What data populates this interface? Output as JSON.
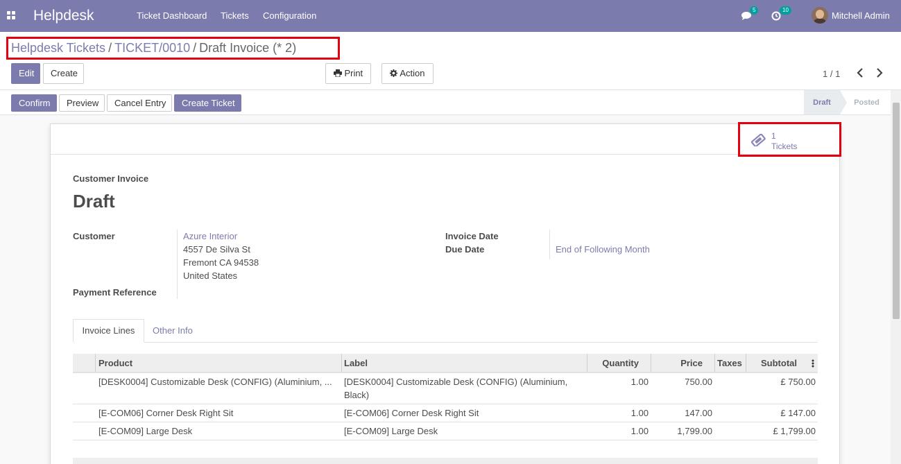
{
  "navbar": {
    "brand": "Helpdesk",
    "menu": [
      "Ticket Dashboard",
      "Tickets",
      "Configuration"
    ],
    "messages_count": "5",
    "activities_count": "10",
    "user_name": "Mitchell Admin"
  },
  "breadcrumb": {
    "root": "Helpdesk Tickets",
    "separator": "/",
    "ticket": "TICKET/0010",
    "current": "Draft Invoice (* 2)"
  },
  "toolbar": {
    "edit_label": "Edit",
    "create_label": "Create",
    "print_label": "Print",
    "action_label": "Action"
  },
  "pager": {
    "value": "1 / 1"
  },
  "statusbar": {
    "buttons": [
      "Confirm",
      "Preview",
      "Cancel Entry",
      "Create Ticket"
    ],
    "stages": [
      "Draft",
      "Posted"
    ],
    "active_stage": "Draft"
  },
  "smart_button": {
    "value": "1",
    "label": "Tickets"
  },
  "invoice": {
    "type_label": "Customer Invoice",
    "name": "Draft",
    "customer_label": "Customer",
    "customer_name": "Azure Interior",
    "address": [
      "4557 De Silva St",
      "Fremont CA 94538",
      "United States"
    ],
    "payment_reference_label": "Payment Reference",
    "invoice_date_label": "Invoice Date",
    "due_date_label": "Due Date",
    "due_date_value": "End of Following Month"
  },
  "tabs": [
    "Invoice Lines",
    "Other Info"
  ],
  "lines_table": {
    "columns": [
      "Product",
      "Label",
      "Quantity",
      "Price",
      "Taxes",
      "Subtotal"
    ],
    "rows": [
      {
        "product": "[DESK0004] Customizable Desk (CONFIG) (Aluminium, ...",
        "label_line1": "[DESK0004] Customizable Desk (CONFIG) (Aluminium,",
        "label_line2": "Black)",
        "quantity": "1.00",
        "price": "750.00",
        "taxes": "",
        "subtotal": "£ 750.00"
      },
      {
        "product": "[E-COM06] Corner Desk Right Sit",
        "label_line1": "[E-COM06] Corner Desk Right Sit",
        "label_line2": "",
        "quantity": "1.00",
        "price": "147.00",
        "taxes": "",
        "subtotal": "£ 147.00"
      },
      {
        "product": "[E-COM09] Large Desk",
        "label_line1": "[E-COM09] Large Desk",
        "label_line2": "",
        "quantity": "1.00",
        "price": "1,799.00",
        "taxes": "",
        "subtotal": "£ 1,799.00"
      }
    ]
  },
  "colors": {
    "brand": "#7c7bad",
    "highlight": "#e3000f"
  }
}
